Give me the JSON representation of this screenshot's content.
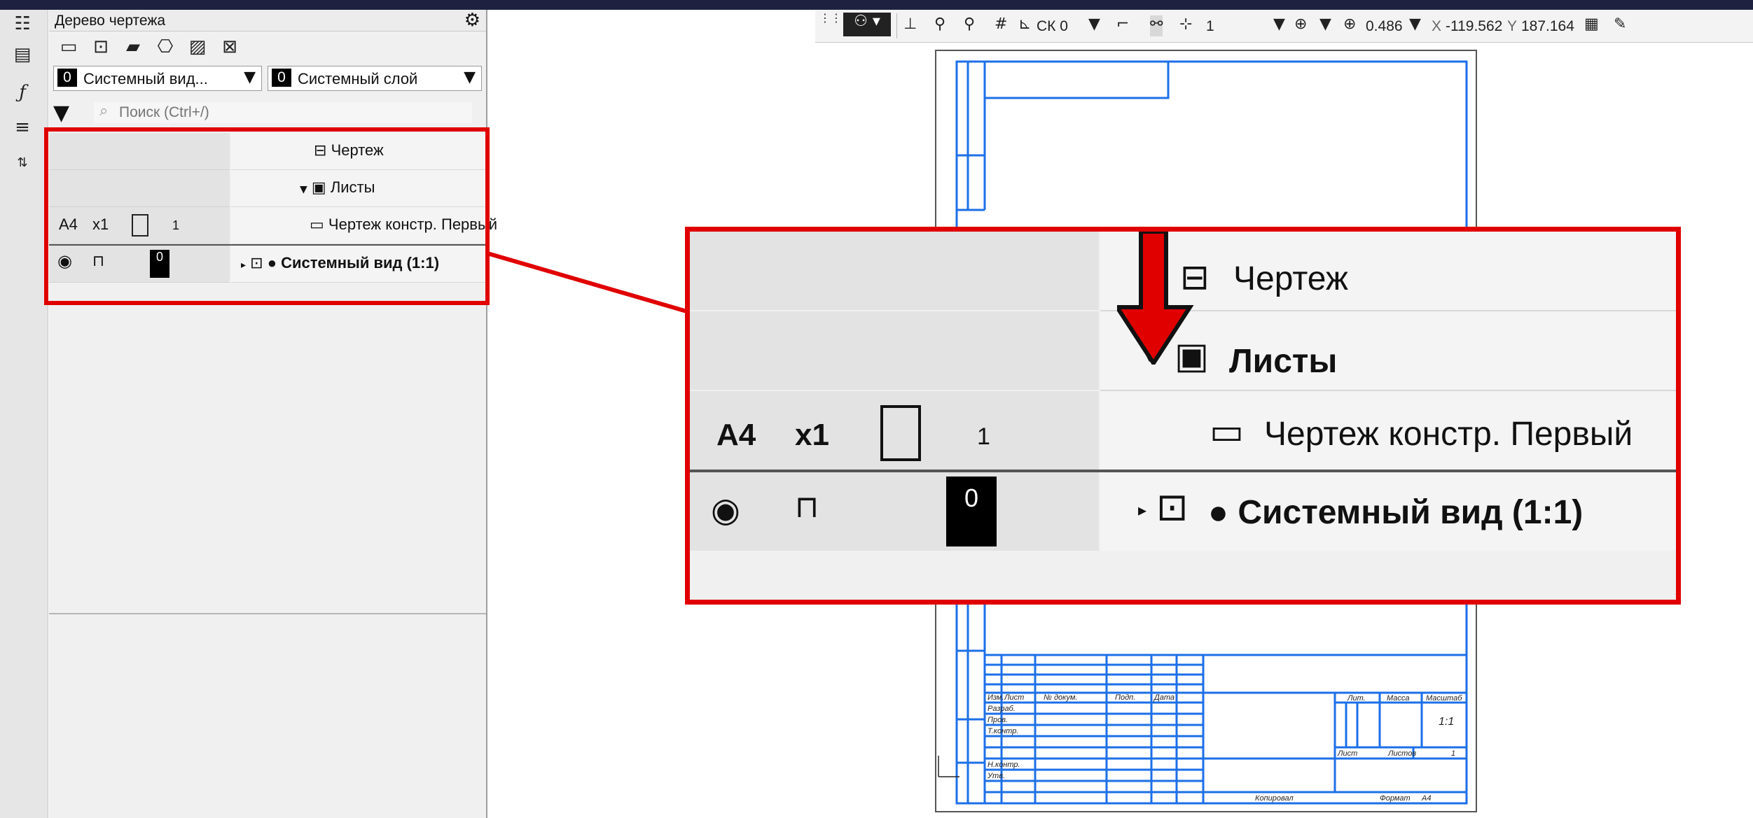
{
  "panel": {
    "title": "Дерево чертежа",
    "view_dropdown": {
      "number": "0",
      "label": "Системный вид..."
    },
    "layer_dropdown": {
      "number": "0",
      "label": "Системный слой"
    },
    "search_placeholder": "Поиск (Ctrl+/)"
  },
  "tree": {
    "root_label": "Чертеж",
    "sheets_label": "Листы",
    "sheet_row": {
      "format": "A4",
      "multiplier": "x1",
      "number": "1",
      "label": "Чертеж констр. Первый"
    },
    "view_row": {
      "layer": "0",
      "label": "● Системный вид (1:1)"
    }
  },
  "toolbar": {
    "cs_label": "СК 0",
    "step_value": "1",
    "zoom_value": "0.486",
    "x_label": "X",
    "x_value": "-119.562",
    "y_label": "Y",
    "y_value": "187.164"
  },
  "zoom": {
    "root_label": "Чертеж",
    "sheets_label": "Листы",
    "format": "A4",
    "multiplier": "x1",
    "number": "1",
    "sheet_label": "Чертеж констр. Первый",
    "layer": "0",
    "view_label": "● Системный вид (1:1)"
  },
  "title_block": {
    "izm": "Изм.",
    "list": "Лист",
    "ndok": "№ докум.",
    "podp": "Подп.",
    "data": "Дата",
    "razrab": "Разраб.",
    "prov": "Пров.",
    "tkontr": "Т.контр.",
    "nkontr": "Н.контр.",
    "utv": "Утв.",
    "lit": "Лит.",
    "massa": "Масса",
    "masshtab": "Масштаб",
    "scale_value": "1:1",
    "list2": "Лист",
    "listov": "Листов",
    "listov_value": "1",
    "kopiroval": "Копировал",
    "format": "Формат",
    "format_value": "A4"
  },
  "colors": {
    "accent_red": "#e00000",
    "drawing_blue": "#1c6fe8",
    "topbar": "#1e2240"
  }
}
